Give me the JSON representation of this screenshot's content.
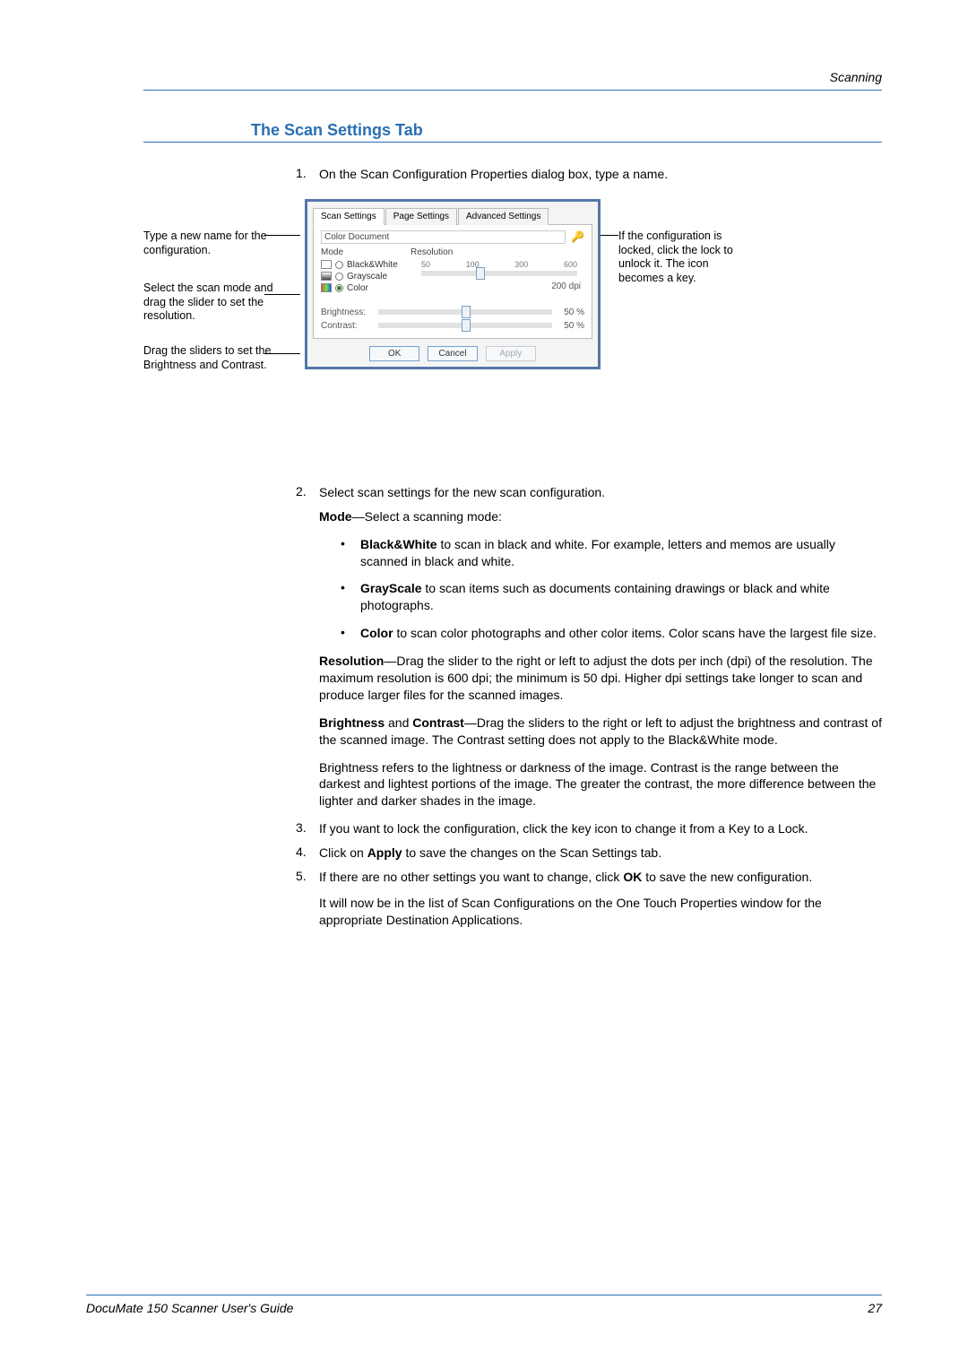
{
  "header": {
    "section": "Scanning"
  },
  "title": "The Scan Settings Tab",
  "steps": {
    "s1_num": "1.",
    "s1_text": "On the Scan Configuration Properties dialog box, type a name.",
    "s2_num": "2.",
    "s2_text": "Select scan settings for the new scan configuration.",
    "s3_num": "3.",
    "s3_text": "If you want to lock the configuration, click the key icon to change it from a Key to a Lock.",
    "s4_num": "4.",
    "s4_pre": "Click on ",
    "s4_bold": "Apply",
    "s4_post": " to save the changes on the Scan Settings tab.",
    "s5_num": "5.",
    "s5_pre": "If there are no other settings you want to change, click ",
    "s5_bold": "OK",
    "s5_post": " to save the new configuration.",
    "s5_follow": "It will now be in the list of Scan Configurations on the One Touch Properties window for the appropriate Destination Applications."
  },
  "callouts": {
    "left1": "Type a new name for the configuration.",
    "left2": "Select the scan mode and drag the slider to set the resolution.",
    "left3": "Drag the sliders to set the Brightness and Contrast.",
    "right1": "If the configuration is locked, click the lock to unlock it. The icon becomes a key."
  },
  "dialog": {
    "tabs": [
      "Scan Settings",
      "Page Settings",
      "Advanced Settings"
    ],
    "name_value": "Color Document",
    "mode_label": "Mode",
    "resolution_label": "Resolution",
    "modes": {
      "bw": "Black&White",
      "gs": "Grayscale",
      "co": "Color"
    },
    "ticks": [
      "50",
      "100",
      "300",
      "600"
    ],
    "dpi_label": "200 dpi",
    "brightness_label": "Brightness:",
    "contrast_label": "Contrast:",
    "brightness_val": "50 %",
    "contrast_val": "50 %",
    "ok": "OK",
    "cancel": "Cancel",
    "apply": "Apply"
  },
  "body": {
    "mode_line_bold": "Mode",
    "mode_line_rest": "—Select a scanning mode:",
    "b1_bold": "Black&White",
    "b1_rest": " to scan in black and white. For example, letters and memos are usually scanned in black and white.",
    "b2_bold": "GrayScale",
    "b2_rest": " to scan items such as documents containing drawings or black and white photographs.",
    "b3_bold": "Color",
    "b3_rest": " to scan color photographs and other color items. Color scans have the largest file size.",
    "res_bold": "Resolution",
    "res_rest": "—Drag the slider to the right or left to adjust the dots per inch (dpi) of the resolution. The maximum resolution is 600 dpi; the minimum is 50 dpi. Higher dpi settings take longer to scan and produce larger files for the scanned images.",
    "bc_bold1": "Brightness",
    "bc_mid": " and ",
    "bc_bold2": "Contrast",
    "bc_rest": "—Drag the sliders to the right or left to adjust the brightness and contrast of the scanned image. The Contrast setting does not apply to the Black&White mode.",
    "bc_para2": "Brightness refers to the lightness or darkness of the image. Contrast is the range between the darkest and lightest portions of the image. The greater the contrast, the more difference between the lighter and darker shades in the image."
  },
  "footer": {
    "left": "DocuMate 150 Scanner User's Guide",
    "right": "27"
  }
}
